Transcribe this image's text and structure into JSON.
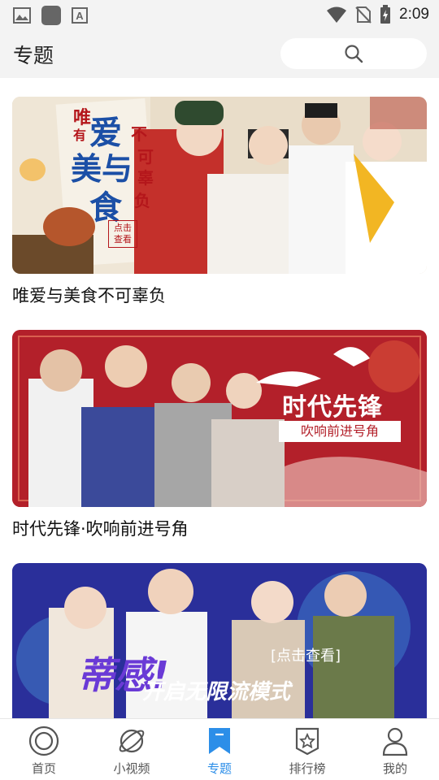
{
  "status_bar": {
    "time": "2:09"
  },
  "header": {
    "title": "专题"
  },
  "cards": [
    {
      "title": "唯爱与美食不可辜负",
      "banner_text": [
        "唯",
        "有",
        "爱",
        "美与",
        "食",
        "不",
        "可",
        "辜",
        "负"
      ],
      "badge": "点击查看"
    },
    {
      "title": "时代先锋·吹响前进号角",
      "banner_heading": "时代先锋",
      "banner_sub": "吹响前进号角"
    },
    {
      "title": "",
      "banner_heading": "蒂感!",
      "banner_sub": "开启无限流模式",
      "banner_tag": "[点击查看]"
    }
  ],
  "tabs": [
    {
      "label": "首页",
      "icon": "home-icon",
      "active": false
    },
    {
      "label": "小视频",
      "icon": "planet-icon",
      "active": false
    },
    {
      "label": "专题",
      "icon": "bookmark-icon",
      "active": true
    },
    {
      "label": "排行榜",
      "icon": "star-badge-icon",
      "active": false
    },
    {
      "label": "我的",
      "icon": "person-icon",
      "active": false
    }
  ],
  "colors": {
    "accent": "#2c8ee8",
    "header_bg": "#f3f3f3",
    "banner2_red": "#b3202a",
    "banner3_blue": "#2a2f9a"
  }
}
